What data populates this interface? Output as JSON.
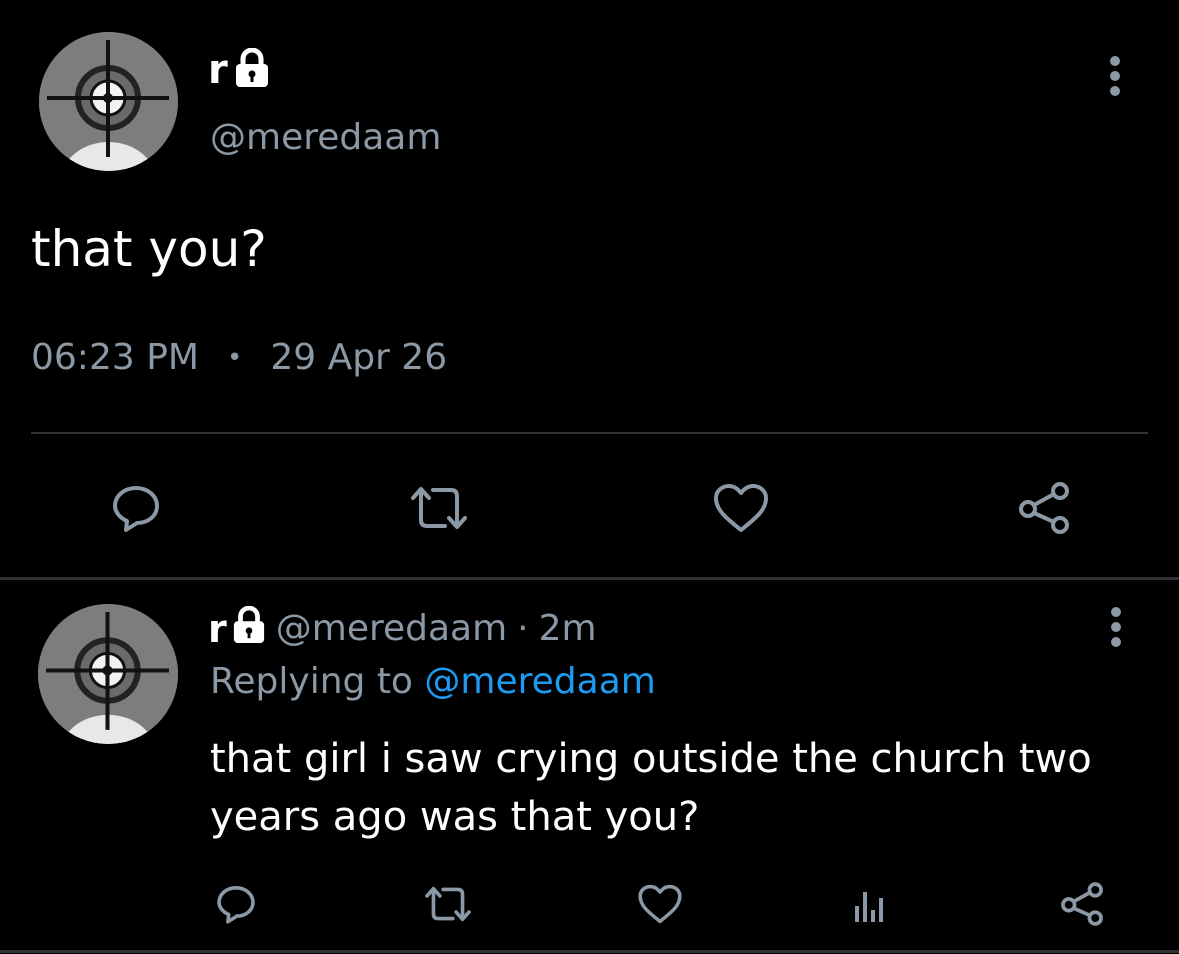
{
  "main_tweet": {
    "display_name": "r",
    "handle": "@meredaam",
    "text": "that you?",
    "time": "06:23 PM",
    "separator": "•",
    "date": "29 Apr 26",
    "icons": {
      "avatar": "avatar-crosshair",
      "lock": "lock-icon",
      "menu": "more-vertical-icon",
      "reply": "reply-icon",
      "retweet": "retweet-icon",
      "like": "heart-icon",
      "share": "share-icon"
    }
  },
  "reply_tweet": {
    "display_name": "r",
    "handle": "@meredaam",
    "dot": "·",
    "age": "2m",
    "replying_prefix": "Replying to",
    "replying_handle": "@meredaam",
    "text_line1": "that girl i saw crying outside the church two",
    "text_line2": "years ago was that you?",
    "icons": {
      "reply": "reply-icon",
      "retweet": "retweet-icon",
      "like": "heart-icon",
      "analytics": "analytics-icon",
      "share": "share-icon"
    }
  },
  "colors": {
    "background": "#000000",
    "text": "#ffffff",
    "muted": "#8b98a5",
    "link": "#1d9bf0",
    "divider": "#2f3336"
  }
}
